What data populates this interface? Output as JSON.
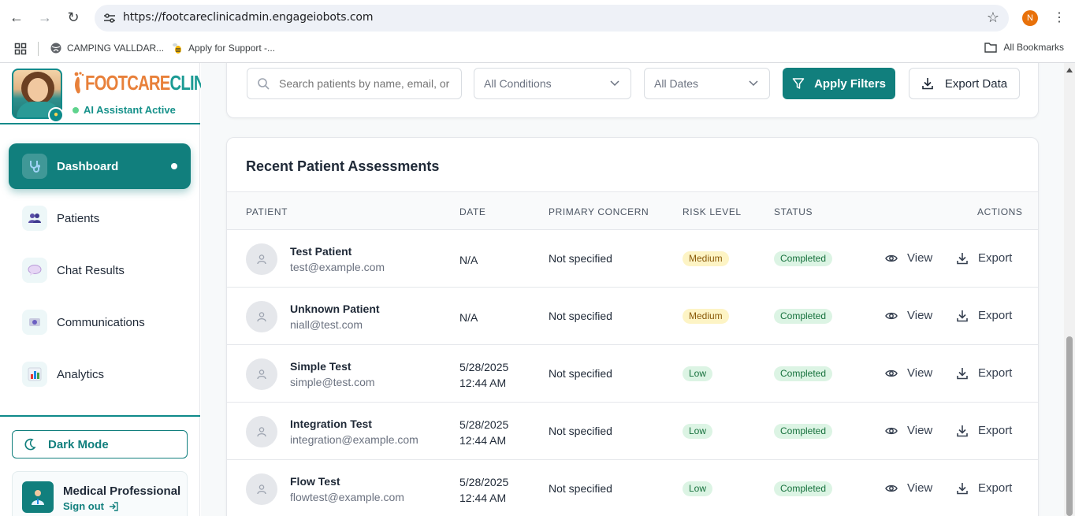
{
  "browser": {
    "url": "https://footcareclinicadmin.engageiobots.com",
    "profile_initial": "N",
    "bookmarks": [
      {
        "label": "CAMPING VALLDAR..."
      },
      {
        "label": "Apply for Support  -..."
      }
    ],
    "all_bookmarks": "All Bookmarks"
  },
  "sidebar": {
    "logo_part1": "FOOTCARE",
    "logo_part2": "CLINIC",
    "ai_status": "AI Assistant Active",
    "items": [
      {
        "label": "Dashboard",
        "icon": "stethoscope-icon",
        "active": true
      },
      {
        "label": "Patients",
        "icon": "people-icon"
      },
      {
        "label": "Chat Results",
        "icon": "speech-bubble-icon"
      },
      {
        "label": "Communications",
        "icon": "envelope-icon"
      },
      {
        "label": "Analytics",
        "icon": "bar-chart-icon"
      }
    ],
    "dark_mode_label": "Dark Mode",
    "user": {
      "name": "Medical Professional",
      "sign_out": "Sign out"
    }
  },
  "filters": {
    "search_placeholder": "Search patients by name, email, or phone",
    "conditions": "All Conditions",
    "dates": "All Dates",
    "apply_label": "Apply Filters",
    "export_label": "Export Data"
  },
  "table": {
    "title": "Recent Patient Assessments",
    "columns": [
      "PATIENT",
      "DATE",
      "PRIMARY CONCERN",
      "RISK LEVEL",
      "STATUS",
      "ACTIONS"
    ],
    "view_label": "View",
    "export_label": "Export",
    "rows": [
      {
        "name": "Test Patient",
        "email": "test@example.com",
        "date": "N/A",
        "time": "",
        "concern": "Not specified",
        "risk": "Medium",
        "status": "Completed"
      },
      {
        "name": "Unknown Patient",
        "email": "niall@test.com",
        "date": "N/A",
        "time": "",
        "concern": "Not specified",
        "risk": "Medium",
        "status": "Completed"
      },
      {
        "name": "Simple Test",
        "email": "simple@test.com",
        "date": "5/28/2025",
        "time": "12:44 AM",
        "concern": "Not specified",
        "risk": "Low",
        "status": "Completed"
      },
      {
        "name": "Integration Test",
        "email": "integration@example.com",
        "date": "5/28/2025",
        "time": "12:44 AM",
        "concern": "Not specified",
        "risk": "Low",
        "status": "Completed"
      },
      {
        "name": "Flow Test",
        "email": "flowtest@example.com",
        "date": "5/28/2025",
        "time": "12:44 AM",
        "concern": "Not specified",
        "risk": "Low",
        "status": "Completed"
      }
    ]
  },
  "colors": {
    "brand_teal": "#117f7d",
    "brand_orange": "#e8803a",
    "risk_medium_bg": "#fdf4c5",
    "risk_low_bg": "#dcf4e4"
  }
}
